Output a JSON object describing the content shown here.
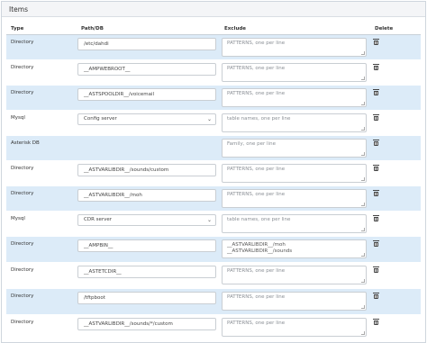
{
  "panel": {
    "title": "Items"
  },
  "columns": {
    "type": "Type",
    "path": "Path/DB",
    "exclude": "Exclude",
    "delete": "Delete"
  },
  "rows": [
    {
      "type": "Directory",
      "path": "/etc/dahdi",
      "path_kind": "input",
      "exclude": "",
      "exclude_placeholder": "PATTERNS, one per line"
    },
    {
      "type": "Directory",
      "path": "__AMPWEBROOT__",
      "path_kind": "input",
      "exclude": "",
      "exclude_placeholder": "PATTERNS, one per line"
    },
    {
      "type": "Directory",
      "path": "__ASTSPOOLDIR__/voicemail",
      "path_kind": "input",
      "exclude": "",
      "exclude_placeholder": "PATTERNS, one per line"
    },
    {
      "type": "Mysql",
      "path": "Config server",
      "path_kind": "select",
      "exclude": "",
      "exclude_placeholder": "table names, one per line"
    },
    {
      "type": "Asterisk DB",
      "path": "",
      "path_kind": "none",
      "exclude": "",
      "exclude_placeholder": "Family, one per line"
    },
    {
      "type": "Directory",
      "path": "__ASTVARLIBDIR__/sounds/custom",
      "path_kind": "input",
      "exclude": "",
      "exclude_placeholder": "PATTERNS, one per line"
    },
    {
      "type": "Directory",
      "path": "__ASTVARLIBDIR__/moh",
      "path_kind": "input",
      "exclude": "",
      "exclude_placeholder": "PATTERNS, one per line"
    },
    {
      "type": "Mysql",
      "path": "CDR server",
      "path_kind": "select",
      "exclude": "",
      "exclude_placeholder": "table names, one per line"
    },
    {
      "type": "Directory",
      "path": "__AMPBIN__",
      "path_kind": "input",
      "exclude": "__ASTVARLIBDIR__/moh\n__ASTVARLIBDIR__/sounds",
      "exclude_placeholder": "PATTERNS, one per line"
    },
    {
      "type": "Directory",
      "path": "__ASTETCDIR__",
      "path_kind": "input",
      "exclude": "",
      "exclude_placeholder": "PATTERNS, one per line"
    },
    {
      "type": "Directory",
      "path": "/tftpboot",
      "path_kind": "input",
      "exclude": "",
      "exclude_placeholder": "PATTERNS, one per line"
    },
    {
      "type": "Directory",
      "path": "__ASTVARLIBDIR__/sounds/*/custom",
      "path_kind": "input",
      "exclude": "",
      "exclude_placeholder": "PATTERNS, one per line"
    }
  ],
  "icons": {
    "delete": "trash-icon",
    "select": "chevron-down-icon"
  },
  "colors": {
    "row_alt": "#dcebf8",
    "header_bg": "#f4f5f7"
  }
}
